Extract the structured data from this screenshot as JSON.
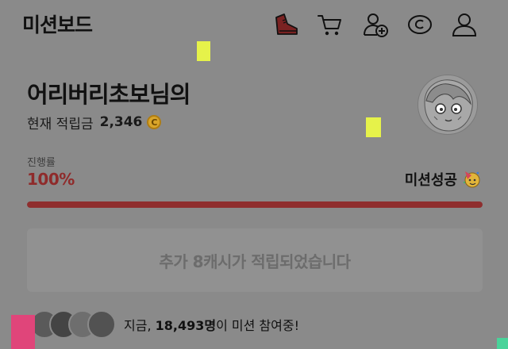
{
  "header": {
    "title": "미션보드",
    "icons": [
      "sneaker-icon",
      "cart-icon",
      "add-friend-icon",
      "cash-icon",
      "profile-icon"
    ]
  },
  "user": {
    "name": "어리버리초보님의",
    "points_label": "현재 적립금",
    "points_value": "2,346",
    "coin_symbol": "C"
  },
  "progress": {
    "label": "진행률",
    "value_text": "100%",
    "fraction": 1.0,
    "status": "미션성공"
  },
  "notice": {
    "text": "추가 8캐시가 적립되었습니다"
  },
  "participants": {
    "prefix": "지금,",
    "count": "18,493명",
    "suffix": "이 미션 참여중!"
  },
  "colors": {
    "accent": "#8f2e2e",
    "background": "#8a8a8a",
    "coin": "#d9a52a"
  }
}
